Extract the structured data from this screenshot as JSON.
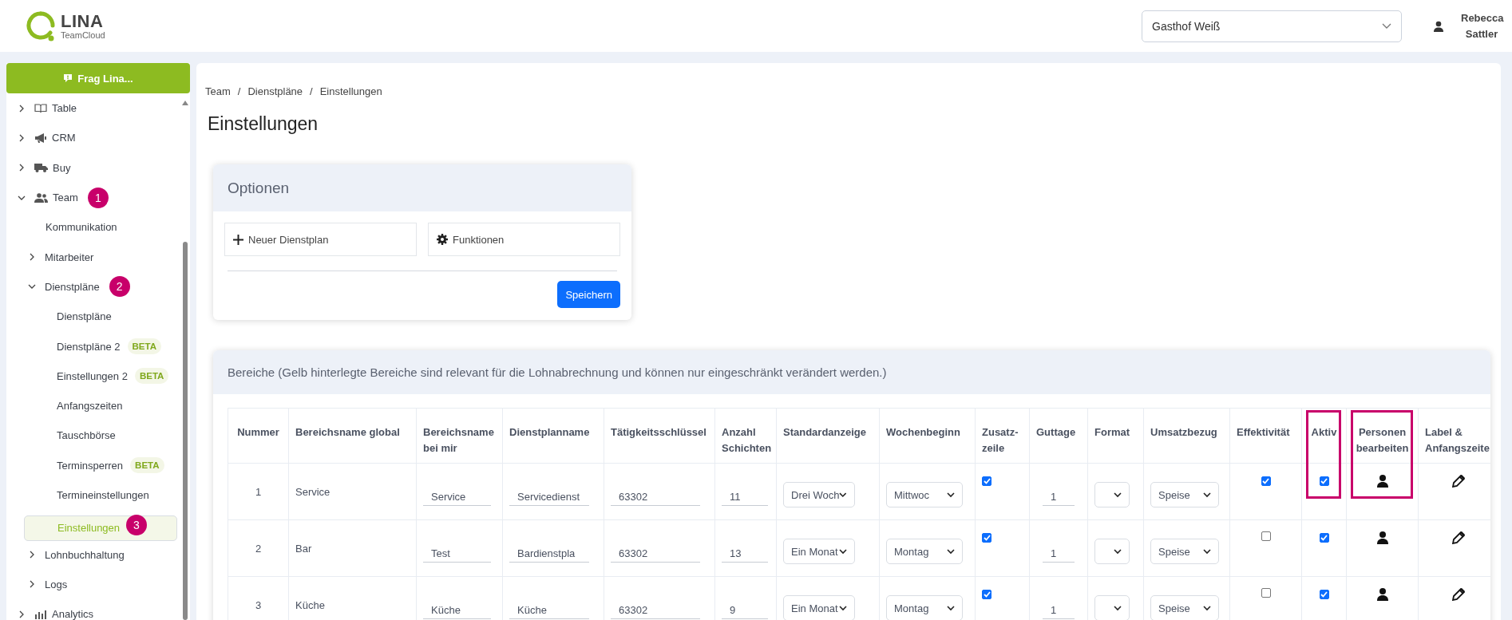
{
  "header": {
    "logo": {
      "name": "LINA",
      "subtitle": "TeamCloud"
    },
    "location_select": {
      "value": "Gasthof Weiß"
    },
    "user": {
      "name": "Rebecca Sattler"
    }
  },
  "sidebar": {
    "ask_button": "Frag Lina...",
    "items": [
      {
        "label": "Table",
        "selected": false,
        "expanded": false
      },
      {
        "label": "CRM",
        "selected": false,
        "expanded": false
      },
      {
        "label": "Buy",
        "selected": false,
        "expanded": false
      },
      {
        "label": "Team",
        "selected": false,
        "expanded": true,
        "marker": "1",
        "children": [
          {
            "label": "Kommunikation",
            "selected": false
          },
          {
            "label": "Mitarbeiter",
            "selected": false,
            "expanded": false
          },
          {
            "label": "Dienstpläne",
            "selected": false,
            "expanded": true,
            "marker": "2",
            "children": [
              {
                "label": "Dienstpläne",
                "selected": false
              },
              {
                "label": "Dienstpläne 2",
                "selected": false,
                "badge": "BETA"
              },
              {
                "label": "Einstellungen 2",
                "selected": false,
                "badge": "BETA"
              },
              {
                "label": "Anfangszeiten",
                "selected": false
              },
              {
                "label": "Tauschbörse",
                "selected": false
              },
              {
                "label": "Terminsperren",
                "selected": false,
                "badge": "BETA"
              },
              {
                "label": "Termineinstellungen",
                "selected": false
              },
              {
                "label": "Einstellungen",
                "selected": true,
                "marker": "3"
              }
            ]
          },
          {
            "label": "Lohnbuchhaltung",
            "selected": false,
            "expanded": false
          },
          {
            "label": "Logs",
            "selected": false,
            "expanded": false
          }
        ]
      },
      {
        "label": "Analytics",
        "selected": false,
        "expanded": false
      }
    ]
  },
  "breadcrumb": {
    "separator": "/",
    "items": [
      "Team",
      "Dienstpläne",
      "Einstellungen"
    ]
  },
  "page_title": "Einstellungen",
  "options": {
    "title": "Optionen",
    "buttons": [
      "Neuer Dienstplan",
      "Funktionen"
    ],
    "save_button": "Speichern"
  },
  "bereiche": {
    "title": "Bereiche (Gelb hinterlegte Bereiche sind relevant für die Lohnabrechnung und können nur eingeschränkt verändert werden.)",
    "columns": [
      {
        "label": "Nummer",
        "highlighted": false
      },
      {
        "label": "Bereichsname global",
        "highlighted": false
      },
      {
        "label": "Bereichsname bei mir",
        "highlighted": false
      },
      {
        "label": "Dienstplanname",
        "highlighted": false
      },
      {
        "label": "Tätigkeitsschlüssel",
        "highlighted": false
      },
      {
        "label": "Anzahl Schichten",
        "highlighted": false
      },
      {
        "label": "Standardanzeige",
        "highlighted": false
      },
      {
        "label": "Wochenbeginn",
        "highlighted": false
      },
      {
        "label": "Zusatz-zeile",
        "highlighted": false
      },
      {
        "label": "Guttage",
        "highlighted": false
      },
      {
        "label": "Format",
        "highlighted": false
      },
      {
        "label": "Umsatzbezug",
        "highlighted": false
      },
      {
        "label": "Effektivität",
        "highlighted": false
      },
      {
        "label": "Aktiv",
        "highlighted": true
      },
      {
        "label": "Personen bearbeiten",
        "highlighted": true
      },
      {
        "label": "Label & Anfangszeite",
        "highlighted": false
      }
    ],
    "rows": [
      {
        "nummer": "1",
        "global": "Service",
        "bei_mir": "Service",
        "dienstplanname": "Servicedienst",
        "schluessel": "63302",
        "schichten": "11",
        "standardanzeige": "Drei Woch",
        "wochenbeginn": "Mittwoc",
        "zusatzzeile": true,
        "guttage": "1",
        "umsatzbezug": "Speise",
        "effektivitaet": true,
        "aktiv": true
      },
      {
        "nummer": "2",
        "global": "Bar",
        "bei_mir": "Test",
        "dienstplanname": "Bardienstpla",
        "schluessel": "63302",
        "schichten": "13",
        "standardanzeige": "Ein Monat",
        "wochenbeginn": "Montag",
        "zusatzzeile": true,
        "guttage": "1",
        "umsatzbezug": "Speise",
        "effektivitaet": false,
        "aktiv": true
      },
      {
        "nummer": "3",
        "global": "Küche",
        "bei_mir": "Küche",
        "dienstplanname": "Küche",
        "schluessel": "63302",
        "schichten": "9",
        "standardanzeige": "Ein Monat",
        "wochenbeginn": "Montag",
        "zusatzzeile": true,
        "guttage": "1",
        "umsatzbezug": "Speise",
        "effektivitaet": false,
        "aktiv": true
      }
    ]
  }
}
